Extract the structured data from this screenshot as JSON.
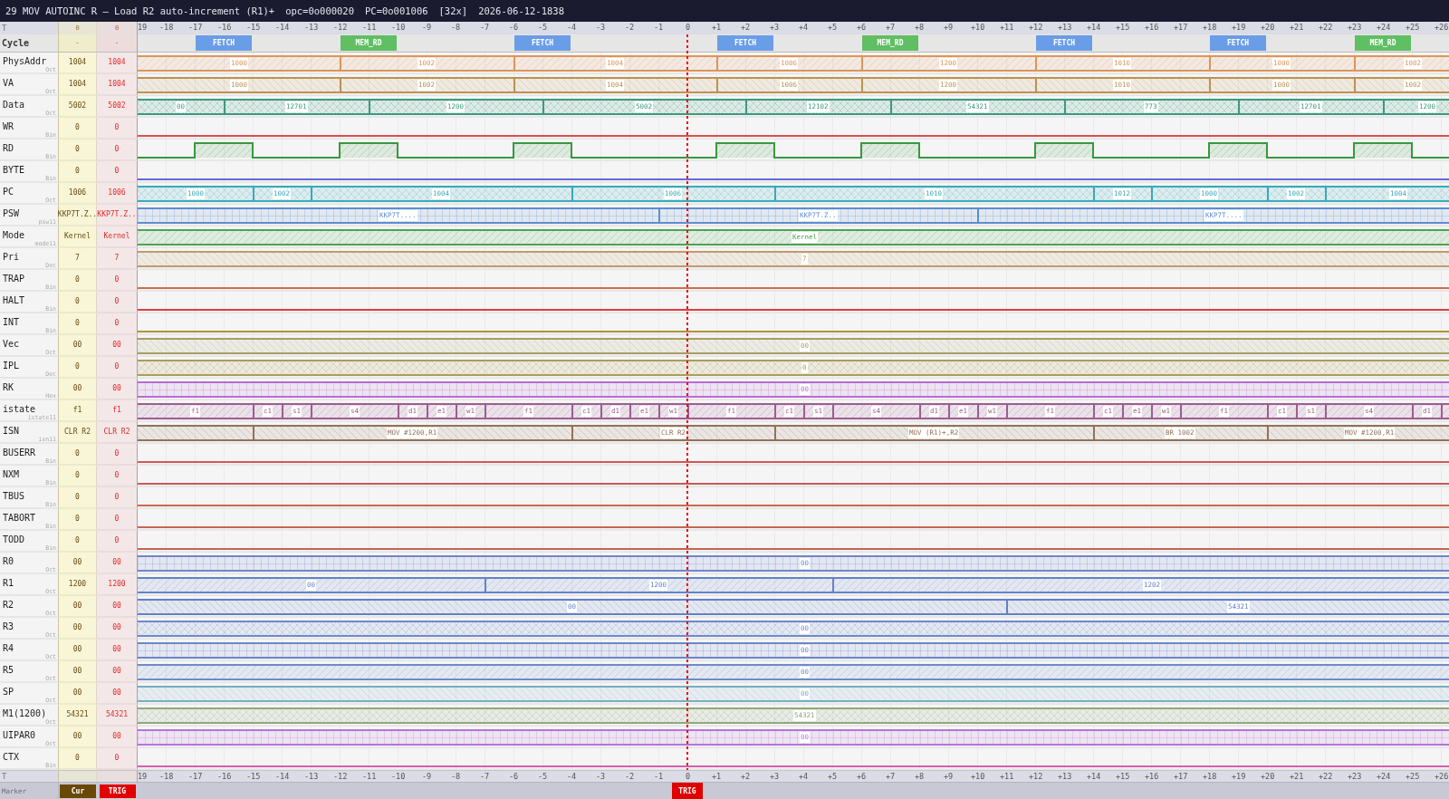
{
  "window": {
    "title_parts": [
      "29 MOV AUTOINC R — Load R2 auto-increment (R1)+",
      "opc=0o000020",
      "PC=0o001006",
      "[32x]",
      "2026-06-12-1838"
    ]
  },
  "ruler": {
    "label": "T",
    "cur": "0",
    "trig": "0",
    "ticks": [
      "19",
      "-18",
      "-17",
      "-16",
      "-15",
      "-14",
      "-13",
      "-12",
      "-11",
      "-10",
      "-9",
      "-8",
      "-7",
      "-6",
      "-5",
      "-4",
      "-3",
      "-2",
      "-1",
      "0",
      "+1",
      "+2",
      "+3",
      "+4",
      "+5",
      "+6",
      "+7",
      "+8",
      "+9",
      "+10",
      "+11",
      "+12",
      "+13",
      "+14",
      "+15",
      "+16",
      "+17",
      "+18",
      "+19",
      "+20",
      "+21",
      "+22",
      "+23",
      "+24",
      "+25",
      "+26"
    ]
  },
  "cycle": {
    "label": "Cycle",
    "cur": "-",
    "trig": "-",
    "phases": [
      {
        "label": "FETCH",
        "color": "#6a9de8"
      },
      {
        "label": "MEM_RD",
        "color": "#5fbf62"
      },
      {
        "label": "FETCH",
        "color": "#6a9de8"
      },
      {
        "label": "FETCH",
        "color": "#6a9de8"
      },
      {
        "label": "MEM_RD",
        "color": "#5fbf62"
      },
      {
        "label": "FETCH",
        "color": "#6a9de8"
      },
      {
        "label": "FETCH",
        "color": "#6a9de8"
      },
      {
        "label": "MEM_RD",
        "color": "#5fbf62"
      }
    ]
  },
  "signals": [
    {
      "name": "PhysAddr",
      "radix": "Oct",
      "cur": "1004",
      "trig": "1004",
      "kind": "bus",
      "color": "#de9458",
      "segments": [
        {
          "value": "1000"
        },
        {
          "value": "1002"
        },
        {
          "value": "1004"
        },
        {
          "value": "1006"
        },
        {
          "value": "1200"
        },
        {
          "value": "1010"
        },
        {
          "value": "1000"
        },
        {
          "value": "1002"
        }
      ]
    },
    {
      "name": "VA",
      "radix": "Oct",
      "cur": "1004",
      "trig": "1004",
      "kind": "bus",
      "color": "#bc9250",
      "segments": [
        {
          "value": "1000"
        },
        {
          "value": "1002"
        },
        {
          "value": "1004"
        },
        {
          "value": "1006"
        },
        {
          "value": "1200"
        },
        {
          "value": "1010"
        },
        {
          "value": "1000"
        },
        {
          "value": "1002"
        }
      ]
    },
    {
      "name": "Data",
      "radix": "Oct",
      "cur": "5002",
      "trig": "5002",
      "kind": "bus",
      "color": "#3a9a7e",
      "segments": [
        {
          "value": "00"
        },
        {
          "value": "12701"
        },
        {
          "value": "1200"
        },
        {
          "value": "5002"
        },
        {
          "value": "12102"
        },
        {
          "value": "54321"
        },
        {
          "value": "773"
        },
        {
          "value": "12701"
        },
        {
          "value": "1200"
        }
      ]
    },
    {
      "name": "WR",
      "radix": "Bin",
      "cur": "0",
      "trig": "0",
      "kind": "bit",
      "color": "#d85050",
      "segments": [
        {
          "high": false
        }
      ]
    },
    {
      "name": "RD",
      "radix": "Bin",
      "cur": "0",
      "trig": "0",
      "kind": "bit",
      "color": "#38983e",
      "segments": [
        {
          "high": false
        },
        {
          "high": true
        },
        {
          "high": false
        },
        {
          "high": true
        },
        {
          "high": false
        },
        {
          "high": true
        },
        {
          "high": false
        },
        {
          "high": true
        },
        {
          "high": false
        },
        {
          "high": true
        },
        {
          "high": false
        },
        {
          "high": true
        },
        {
          "high": false
        },
        {
          "high": true
        },
        {
          "high": false
        },
        {
          "high": true
        },
        {
          "high": false
        }
      ]
    },
    {
      "name": "BYTE",
      "radix": "Bin",
      "cur": "0",
      "trig": "0",
      "kind": "bit",
      "color": "#6468d4",
      "segments": [
        {
          "high": false
        }
      ]
    },
    {
      "name": "PC",
      "radix": "Oct",
      "cur": "1006",
      "trig": "1006",
      "kind": "bus",
      "color": "#38aabb",
      "segments": [
        {
          "value": "1000"
        },
        {
          "value": "1002"
        },
        {
          "value": "1004"
        },
        {
          "value": "1006"
        },
        {
          "value": "1010"
        },
        {
          "value": "1012"
        },
        {
          "value": "1000"
        },
        {
          "value": "1002"
        },
        {
          "value": "1004"
        }
      ]
    },
    {
      "name": "PSW",
      "radix": "psw11",
      "cur": "KKP7T.Z..",
      "trig": "KKP7T.Z..",
      "kind": "bus",
      "color": "#5a8ed0",
      "segments": [
        {
          "value": "KKP7T...."
        },
        {
          "value": "KKP7T.Z.."
        },
        {
          "value": "KKP7T...."
        }
      ]
    },
    {
      "name": "Mode",
      "radix": "mode11",
      "cur": "Kernel",
      "trig": "Kernel",
      "kind": "bus",
      "color": "#4ca450",
      "segments": [
        {
          "value": "Kernel"
        }
      ]
    },
    {
      "name": "Pri",
      "radix": "Dec",
      "cur": "7",
      "trig": "7",
      "kind": "bus",
      "color": "#c09a6a",
      "segments": [
        {
          "value": "7"
        }
      ]
    },
    {
      "name": "TRAP",
      "radix": "Bin",
      "cur": "0",
      "trig": "0",
      "kind": "bit",
      "color": "#d06c4e",
      "segments": [
        {
          "high": false
        }
      ]
    },
    {
      "name": "HALT",
      "radix": "Bin",
      "cur": "0",
      "trig": "0",
      "kind": "bit",
      "color": "#e03c3c",
      "segments": [
        {
          "high": false
        }
      ]
    },
    {
      "name": "INT",
      "radix": "Bin",
      "cur": "0",
      "trig": "0",
      "kind": "bit",
      "color": "#b09236",
      "segments": [
        {
          "high": false
        }
      ]
    },
    {
      "name": "Vec",
      "radix": "Oct",
      "cur": "00",
      "trig": "00",
      "kind": "bus",
      "color": "#a89c64",
      "segments": [
        {
          "value": "00"
        }
      ]
    },
    {
      "name": "IPL",
      "radix": "Dec",
      "cur": "0",
      "trig": "0",
      "kind": "bus",
      "color": "#ab9e56",
      "segments": [
        {
          "value": "0"
        }
      ]
    },
    {
      "name": "RK",
      "radix": "Hex",
      "cur": "00",
      "trig": "00",
      "kind": "bus",
      "color": "#b86cd2",
      "segments": [
        {
          "value": "00"
        }
      ]
    },
    {
      "name": "istate",
      "radix": "istate11",
      "cur": "f1",
      "trig": "f1",
      "kind": "bus",
      "color": "#9e5c92",
      "segments": [
        {
          "value": "f1"
        },
        {
          "value": "c1"
        },
        {
          "value": "s1"
        },
        {
          "value": "s4"
        },
        {
          "value": "d1"
        },
        {
          "value": "e1"
        },
        {
          "value": "w1"
        },
        {
          "value": "f1"
        },
        {
          "value": "c1"
        },
        {
          "value": "d1"
        },
        {
          "value": "e1"
        },
        {
          "value": "w1"
        },
        {
          "value": "f1"
        },
        {
          "value": "c1"
        },
        {
          "value": "s1"
        },
        {
          "value": "s4"
        },
        {
          "value": "d1"
        },
        {
          "value": "e1"
        },
        {
          "value": "w1"
        },
        {
          "value": "f1"
        },
        {
          "value": "c1"
        },
        {
          "value": "e1"
        },
        {
          "value": "w1"
        },
        {
          "value": "f1"
        },
        {
          "value": "c1"
        },
        {
          "value": "s1"
        },
        {
          "value": "s4"
        },
        {
          "value": "d1"
        }
      ]
    },
    {
      "name": "ISN",
      "radix": "isn11",
      "cur": "CLR R2",
      "trig": "CLR R2",
      "kind": "bus",
      "color": "#927258",
      "segments": [
        {
          "value": "MOV #1200,R1"
        },
        {
          "value": "CLR R2"
        },
        {
          "value": "MOV (R1)+,R2"
        },
        {
          "value": "BR 1002"
        },
        {
          "value": "MOV #1200,R1"
        }
      ]
    },
    {
      "name": "BUSERR",
      "radix": "Bin",
      "cur": "0",
      "trig": "0",
      "kind": "bit",
      "color": "#d65656",
      "segments": [
        {
          "high": false
        }
      ]
    },
    {
      "name": "NXM",
      "radix": "Bin",
      "cur": "0",
      "trig": "0",
      "kind": "bit",
      "color": "#c85a5a",
      "segments": [
        {
          "high": false
        }
      ]
    },
    {
      "name": "TBUS",
      "radix": "Bin",
      "cur": "0",
      "trig": "0",
      "kind": "bit",
      "color": "#c8684e",
      "segments": [
        {
          "high": false
        }
      ]
    },
    {
      "name": "TABORT",
      "radix": "Bin",
      "cur": "0",
      "trig": "0",
      "kind": "bit",
      "color": "#c6664e",
      "segments": [
        {
          "high": false
        }
      ]
    },
    {
      "name": "TODD",
      "radix": "Bin",
      "cur": "0",
      "trig": "0",
      "kind": "bit",
      "color": "#c46450",
      "segments": [
        {
          "high": false
        }
      ]
    },
    {
      "name": "R0",
      "radix": "Oct",
      "cur": "00",
      "trig": "00",
      "kind": "bus",
      "color": "#6c86cc",
      "segments": [
        {
          "value": "00"
        }
      ]
    },
    {
      "name": "R1",
      "radix": "Oct",
      "cur": "1200",
      "trig": "1200",
      "kind": "bus",
      "color": "#6482ca",
      "segments": [
        {
          "value": "00"
        },
        {
          "value": "1200"
        },
        {
          "value": "1202"
        }
      ]
    },
    {
      "name": "R2",
      "radix": "Oct",
      "cur": "00",
      "trig": "00",
      "kind": "bus",
      "color": "#6280c8",
      "segments": [
        {
          "value": "00"
        },
        {
          "value": "54321"
        }
      ]
    },
    {
      "name": "R3",
      "radix": "Oct",
      "cur": "00",
      "trig": "00",
      "kind": "bus",
      "color": "#6e88cc",
      "segments": [
        {
          "value": "00"
        }
      ]
    },
    {
      "name": "R4",
      "radix": "Oct",
      "cur": "00",
      "trig": "00",
      "kind": "bus",
      "color": "#6a86ca",
      "segments": [
        {
          "value": "00"
        }
      ]
    },
    {
      "name": "R5",
      "radix": "Oct",
      "cur": "00",
      "trig": "00",
      "kind": "bus",
      "color": "#6e8acc",
      "segments": [
        {
          "value": "00"
        }
      ]
    },
    {
      "name": "SP",
      "radix": "Oct",
      "cur": "00",
      "trig": "00",
      "kind": "bus",
      "color": "#78aec4",
      "segments": [
        {
          "value": "00"
        }
      ]
    },
    {
      "name": "M1(1200)",
      "radix": "Oct",
      "cur": "54321",
      "trig": "54321",
      "kind": "bus",
      "color": "#90a87a",
      "segments": [
        {
          "value": "54321"
        }
      ]
    },
    {
      "name": "UIPAR0",
      "radix": "Oct",
      "cur": "00",
      "trig": "00",
      "kind": "bus",
      "color": "#b872d8",
      "segments": [
        {
          "value": "00"
        }
      ]
    },
    {
      "name": "CTX",
      "radix": "Bin",
      "cur": "0",
      "trig": "0",
      "kind": "bit",
      "color": "#d060a8",
      "segments": [
        {
          "high": false
        }
      ]
    }
  ],
  "bottom_ruler": {
    "label": "T",
    "ticks": [
      "19",
      "-18",
      "-17",
      "-16",
      "-15",
      "-14",
      "-13",
      "-12",
      "-11",
      "-10",
      "-9",
      "-8",
      "-7",
      "-6",
      "-5",
      "-4",
      "-3",
      "-2",
      "-1",
      "0",
      "+1",
      "+2",
      "+3",
      "+4",
      "+5",
      "+6",
      "+7",
      "+8",
      "+9",
      "+10",
      "+11",
      "+12",
      "+13",
      "+14",
      "+15",
      "+16",
      "+17",
      "+18",
      "+19",
      "+20",
      "+21",
      "+22",
      "+23",
      "+24",
      "+25",
      "+26"
    ]
  },
  "markers": {
    "label": "Marker",
    "cur": "Cur",
    "trig": "TRIG",
    "trigger_label": "TRIG"
  }
}
